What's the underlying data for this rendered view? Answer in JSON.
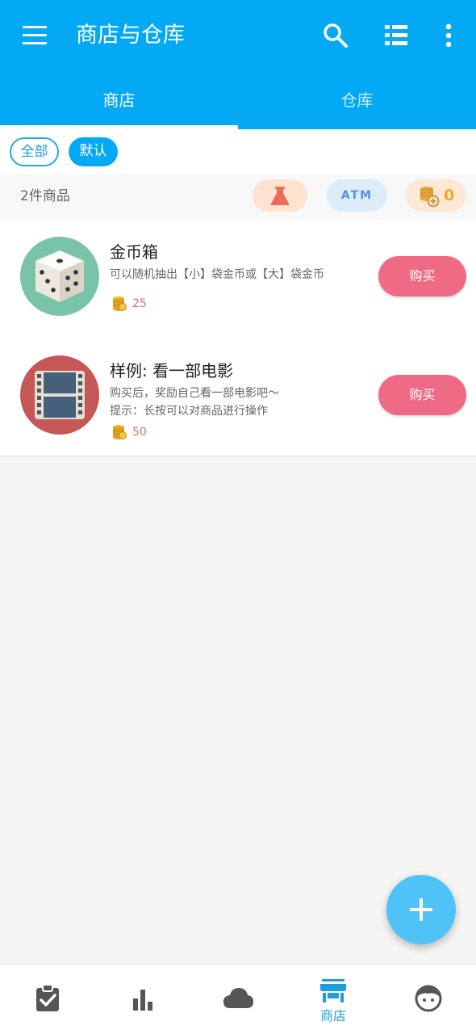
{
  "app_bar": {
    "title": "商店与仓库",
    "menu_icon": "hamburger-menu-icon",
    "search_icon": "search-icon",
    "list_icon": "list-view-icon",
    "more_icon": "more-vert-icon",
    "background_color": "#03a9f4"
  },
  "tabs": [
    {
      "label": "商店",
      "selected": true
    },
    {
      "label": "仓库",
      "selected": false
    }
  ],
  "filters": {
    "chips": [
      {
        "label": "全部",
        "selected": false
      },
      {
        "label": "默认",
        "selected": true
      }
    ]
  },
  "summary": {
    "item_count": "2件商品",
    "potion_icon": "flask-icon",
    "atm_label": "ATM",
    "coins_icon": "coin-stack-add-icon",
    "coin_balance": "0"
  },
  "goods": [
    {
      "name": "金币箱",
      "icon": "dice-icon",
      "description_lines": [
        "可以随机抽出【小】袋金币或【大】袋金币"
      ],
      "price": "25",
      "buy_label": "购买"
    },
    {
      "name": "样例: 看一部电影",
      "icon": "film-strip-icon",
      "description_lines": [
        "购买后，奖励自己看一部电影吧～",
        "提示：长按可以对商品进行操作"
      ],
      "price": "50",
      "buy_label": "购买"
    }
  ],
  "fab": {
    "icon": "plus-icon",
    "color": "#4fc3f7"
  },
  "bottom_nav": [
    {
      "icon": "clipboard-check-icon",
      "label": "",
      "selected": false
    },
    {
      "icon": "bar-chart-icon",
      "label": "",
      "selected": false
    },
    {
      "icon": "cloud-icon",
      "label": "",
      "selected": false
    },
    {
      "icon": "store-icon",
      "label": "商店",
      "selected": true
    },
    {
      "icon": "face-icon",
      "label": "",
      "selected": false
    }
  ],
  "colors": {
    "accent": "#03a9f4",
    "buy_button": "#ef6b85",
    "coin_text": "#f5a623",
    "price_text": "#e06a6a"
  }
}
